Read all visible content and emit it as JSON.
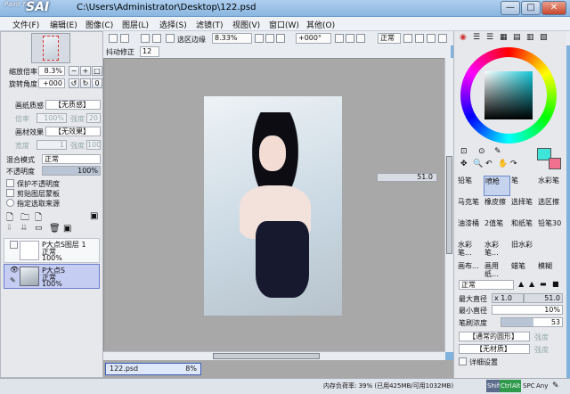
{
  "window": {
    "app_logo": "Paint Tool SAI",
    "title": "C:\\Users\\Administrator\\Desktop\\122.psd",
    "min": "—",
    "max": "□",
    "close": "✕"
  },
  "menu": [
    "文件(F)",
    "编辑(E)",
    "图像(C)",
    "图层(L)",
    "选择(S)",
    "滤镜(T)",
    "视图(V)",
    "窗口(W)",
    "其他(O)"
  ],
  "toolbar": {
    "select_edge": "选区边缘",
    "zoom": "8.33%",
    "angle": "+000°",
    "mode": "正常",
    "stabilizer_label": "抖动修正",
    "stabilizer": "12"
  },
  "navigator": {
    "zoom_label": "缩放倍率",
    "zoom": "8.3%",
    "rotate_label": "旋转角度",
    "rotate": "+000"
  },
  "paper": {
    "texture_label": "画纸质感",
    "texture": "【无质感】",
    "scale_label": "倍率",
    "scale": "100%",
    "strength_label": "强度",
    "strength": "20",
    "effect_label": "画材效果",
    "effect": "【无效果】",
    "width_label": "宽度",
    "width": "1",
    "intensity_label": "强度",
    "intensity": "100"
  },
  "layer_props": {
    "blend_label": "混合模式",
    "blend": "正常",
    "opacity_label": "不透明度",
    "opacity": "100%",
    "protect": "保护不透明度",
    "clip": "剪贴图层蒙板",
    "source": "指定选取来源"
  },
  "layers": [
    {
      "name": "P大点S图层 1",
      "mode": "正常",
      "opacity": "100%",
      "selected": false
    },
    {
      "name": "P大点S",
      "mode": "正常",
      "opacity": "100%",
      "selected": true
    }
  ],
  "canvas": {
    "value": "51.0"
  },
  "doc_tab": {
    "name": "122.psd",
    "zoom": "8%"
  },
  "tools_top": [
    "⊡",
    "⊙",
    "✎",
    "⤢",
    "✥",
    "🔍",
    "↶",
    "✋",
    "↷"
  ],
  "tools": [
    [
      "铅笔",
      "喷枪",
      "笔",
      "水彩笔"
    ],
    [
      "马克笔",
      "橡皮擦",
      "选择笔",
      "选区擦"
    ],
    [
      "油漆桶",
      "2值笔",
      "和纸笔",
      "铅笔30"
    ],
    [
      "水彩笔...",
      "水彩笔...",
      "旧水彩",
      ""
    ],
    [
      "画布...",
      "画用纸...",
      "蜡笔",
      "模糊"
    ]
  ],
  "brush": {
    "mode": "正常",
    "max_label": "最大直径",
    "max_mult": "x 1.0",
    "max": "51.0",
    "min_label": "最小直径",
    "min": "10%",
    "density_label": "笔刷浓度",
    "density": "53",
    "shape": "【通常的圆形】",
    "texture": "【无材质】",
    "strength1": "强度",
    "strength2": "强度",
    "detail": "详细设置"
  },
  "status": {
    "memory": "内存负荷率: 39% (已用425MB/可用1032MB)",
    "keys": [
      "Shift",
      "Ctrl",
      "Alt",
      "SPC",
      "Any"
    ]
  },
  "colors": {
    "accent": "#3a5fb5",
    "primary_color": "#3fe5d8",
    "secondary_color": "#f07090"
  }
}
